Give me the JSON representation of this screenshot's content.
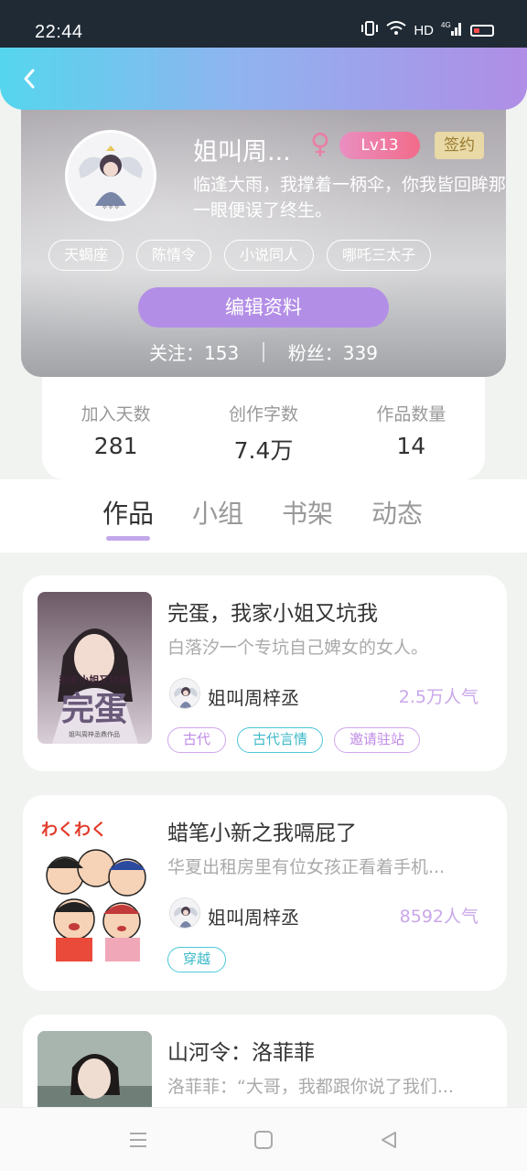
{
  "status_bar": {
    "time": "22:44",
    "network": "HD",
    "signal": "4G"
  },
  "profile": {
    "nickname": "姐叫周...",
    "level": "Lv13",
    "signed": "签约",
    "motto": "临逢大雨，我撑着一柄伞，你我皆回眸那一眼便误了终生。",
    "tags": [
      "天蝎座",
      "陈情令",
      "小说同人",
      "哪吒三太子"
    ],
    "edit_label": "编辑资料",
    "following": "关注：153",
    "fans": "粉丝：339"
  },
  "stats": [
    {
      "label": "加入天数",
      "value": "281"
    },
    {
      "label": "创作字数",
      "value": "7.4万"
    },
    {
      "label": "作品数量",
      "value": "14"
    }
  ],
  "tabs": [
    "作品",
    "小组",
    "书架",
    "动态"
  ],
  "books": [
    {
      "title": "完蛋，我家小姐又坑我",
      "desc": "白落汐一个专坑自己婢女的女人。",
      "author": "姐叫周梓丞",
      "popularity": "2.5万人气",
      "tags": [
        "古代",
        "古代言情",
        "邀请驻站"
      ],
      "cover_text_top": "我家小姐又坑我",
      "cover_text_big": "完蛋",
      "cover_text_small": "姐叫周梓丞鼎作品"
    },
    {
      "title": "蜡笔小新之我嗝屁了",
      "desc": "华夏出租房里有位女孩正看着手机...",
      "author": "姐叫周梓丞",
      "popularity": "8592人气",
      "tags": [
        "穿越"
      ],
      "cover_text_top": "わくわく"
    },
    {
      "title": "山河令：洛菲菲",
      "desc": "洛菲菲：“大哥，我都跟你说了我们...",
      "author": "姐叫周梓丞",
      "popularity": "",
      "tags": []
    }
  ],
  "colors": {
    "accent": "#b38ee6",
    "header_start": "#55d6ee",
    "header_end": "#b08de6",
    "teal": "#3ab8c9"
  }
}
